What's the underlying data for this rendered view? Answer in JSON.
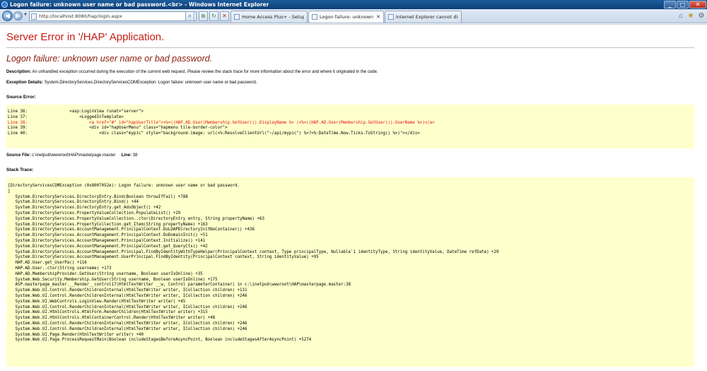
{
  "window": {
    "title": "Logon failure: unknown user name or bad password.<br> - Windows Internet Explorer",
    "minimize": "_",
    "maximize": "□",
    "close": "✕"
  },
  "toolbar": {
    "back": "◀",
    "forward": "▶",
    "dropdown": "▼",
    "url": "http://localhost:8080/hap/login.aspx",
    "search_glyph": "⌕",
    "compat_glyph": "⧉",
    "refresh_glyph": "↻",
    "stop_glyph": "✕",
    "home_glyph": "⌂",
    "favorites_glyph": "★",
    "tools_glyph": "⚙"
  },
  "tabs": [
    {
      "label": "Home Access Plus+ - Setup",
      "close": ""
    },
    {
      "label": "Logon failure: unknown user...",
      "close": "✕"
    },
    {
      "label": "Internet Explorer cannot displa...",
      "close": ""
    }
  ],
  "page": {
    "heading": "Server Error in '/HAP' Application.",
    "error_title": "Logon failure: unknown user name or bad password.",
    "description_label": "Description:",
    "description_text": "An unhandled exception occurred during the execution of the current web request. Please review the stack trace for more information about the error and where it originated in the code.",
    "exception_label": "Exception Details:",
    "exception_text": "System.DirectoryServices.DirectoryServicesCOMException: Logon failure: unknown user name or bad password.",
    "source_error_label": "Source Error:",
    "source_lines": [
      "Line 36:                 <asp:LoginView runat=\"server\">",
      "Line 37:                     <LoggedInTemplate>",
      "Line 38:                         <a href=\"#\" id=\"hapUserTitle\"><%=((HAP.AD.User)Membership.GetUser()).DisplayName %> (<%=((HAP.AD.User)Membership.GetUser()).UserName %>)</a>",
      "Line 39:                         <div id=\"hapUserMenu\" class=\"hapmenu tile-border-color\">",
      "Line 40:                             <div class=\"mypic\" style=\"background-image: url(<%:ResolveClientUrl(\"~/api/mypic\") %>?<%:DateTime.Now.Ticks.ToString() %>)\"></div>"
    ],
    "source_file_label": "Source File:",
    "source_file": "c:\\inetpub\\wwwroot\\HAP\\masterpage.master",
    "line_label": "Line:",
    "line_number": "38",
    "stack_trace_label": "Stack Trace:",
    "stack_trace": "[DirectoryServicesCOMException (0x8007052e): Logon failure: unknown user name or bad password.\n]\n   System.DirectoryServices.DirectoryEntry.Bind(Boolean throwIfFail) +788\n   System.DirectoryServices.DirectoryEntry.Bind() +44\n   System.DirectoryServices.DirectoryEntry.get_AdsObject() +42\n   System.DirectoryServices.PropertyValueCollection.PopulateList() +29\n   System.DirectoryServices.PropertyValueCollection..ctor(DirectoryEntry entry, String propertyName) +63\n   System.DirectoryServices.PropertyCollection.get_Item(String propertyName) +163\n   System.DirectoryServices.AccountManagement.PrincipalContext.DoLDAPDirectoryInitNoContainer() +436\n   System.DirectoryServices.AccountManagement.PrincipalContext.DoDomainInit() +51\n   System.DirectoryServices.AccountManagement.PrincipalContext.Initialize() +141\n   System.DirectoryServices.AccountManagement.PrincipalContext.get_QueryCtx() +42\n   System.DirectoryServices.AccountManagement.Principal.FindByIdentityWithTypeHelper(PrincipalContext context, Type principalType, Nullable`1 identityType, String identityValue, DateTime refDate) +29\n   System.DirectoryServices.AccountManagement.UserPrincipal.FindByIdentity(PrincipalContext context, String identityValue) +95\n   HAP.AD.User.get_UserPa() +116\n   HAP.AD.User..ctor(String username) +173\n   HAP.AD.MembershipProvider.GetUser(String username, Boolean userIsOnline) +35\n   System.Web.Security.Membership.GetUser(String username, Boolean userIsOnline) +175\n   ASP.masterpage_master.__Render__control17(HtmlTextWriter __w, Control parameterContainer) in c:\\inetpub\\wwwroot\\HAP\\masterpage.master:38\n   System.Web.UI.Control.RenderChildrenInternal(HtmlTextWriter writer, ICollection children) +131\n   System.Web.UI.Control.RenderChildrenInternal(HtmlTextWriter writer, ICollection children) +246\n   System.Web.UI.WebControls.LoginView.Render(HtmlTextWriter writer) +45\n   System.Web.UI.Control.RenderChildrenInternal(HtmlTextWriter writer, ICollection children) +246\n   System.Web.UI.HtmlControls.HtmlForm.RenderChildren(HtmlTextWriter writer) +315\n   System.Web.UI.HtmlControls.HtmlContainerControl.Render(HtmlTextWriter writer) +48\n   System.Web.UI.Control.RenderChildrenInternal(HtmlTextWriter writer, ICollection children) +246\n   System.Web.UI.Control.RenderChildrenInternal(HtmlTextWriter writer, ICollection children) +246\n   System.Web.UI.Page.Render(HtmlTextWriter writer) +40\n   System.Web.UI.Page.ProcessRequestMain(Boolean includeStagesBeforeAsyncPoint, Boolean includeStagesAfterAsyncPoint) +5274"
  }
}
